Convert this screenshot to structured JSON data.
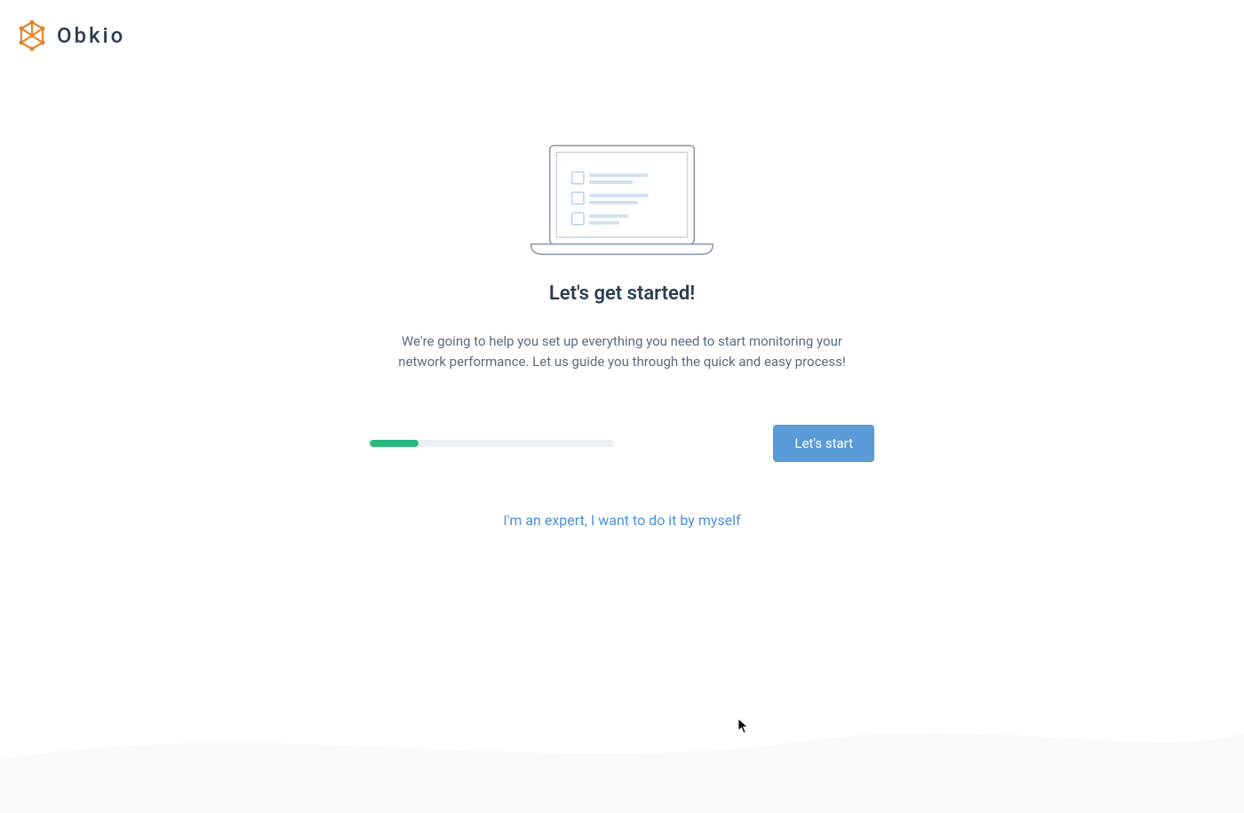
{
  "brand": {
    "name": "Obkio"
  },
  "onboarding": {
    "title": "Let's get started!",
    "description": "We're going to help you set up everything you need to start monitoring your network performance. Let us guide you through the quick and easy process!",
    "start_button_label": "Let's start",
    "expert_link_label": "I'm an expert, I want to do it by myself",
    "progress_percent": 20
  },
  "colors": {
    "brand_orange": "#e8842a",
    "primary_blue": "#5a9bd8",
    "link_blue": "#4a90d9",
    "progress_green": "#29b97b",
    "text_dark": "#2c3e50",
    "text_muted": "#5a6c7d"
  }
}
